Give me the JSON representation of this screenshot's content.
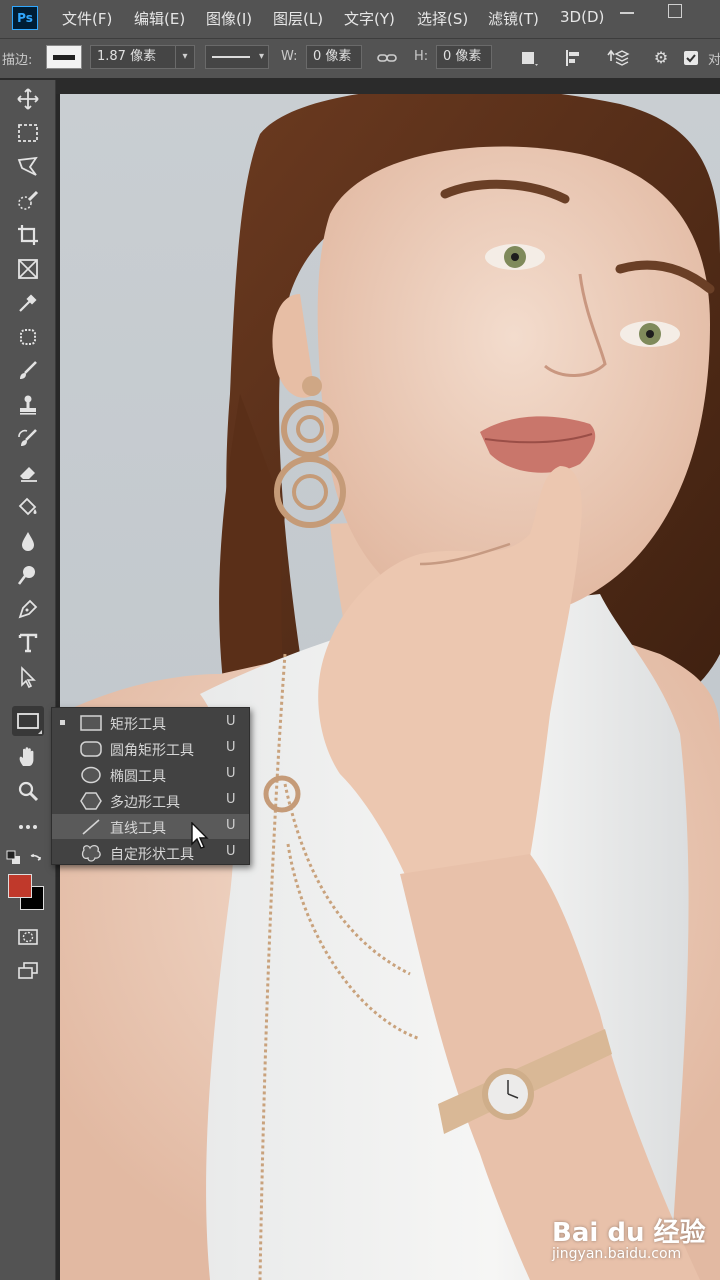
{
  "app": {
    "logo": "Ps",
    "menu": [
      "文件(F)",
      "编辑(E)",
      "图像(I)",
      "图层(L)",
      "文字(Y)",
      "选择(S)",
      "滤镜(T)",
      "3D(D)"
    ]
  },
  "options_bar": {
    "stroke_label": "描边:",
    "stroke_width": "1.87 像素",
    "w_label": "W:",
    "w_value": "0 像素",
    "h_label": "H:",
    "h_value": "0 像素",
    "trailing_label": "对"
  },
  "toolbar": {
    "tools": [
      "move-tool",
      "marquee-tool",
      "lasso-tool",
      "quick-selection-tool",
      "crop-tool",
      "frame-tool",
      "eyedropper-tool",
      "healing-brush-tool",
      "brush-tool",
      "clone-stamp-tool",
      "history-brush-tool",
      "eraser-tool",
      "paint-bucket-tool",
      "blur-tool",
      "dodge-tool",
      "pen-tool",
      "type-tool",
      "path-selection-tool",
      "rectangle-tool",
      "hand-tool",
      "zoom-tool",
      "edit-toolbar"
    ],
    "foreground_color": "#c0392b",
    "background_color": "#000000"
  },
  "flyout": {
    "items": [
      {
        "label": "矩形工具",
        "key": "U",
        "icon": "rectangle-icon",
        "selected": true
      },
      {
        "label": "圆角矩形工具",
        "key": "U",
        "icon": "rounded-rectangle-icon",
        "selected": false
      },
      {
        "label": "椭圆工具",
        "key": "U",
        "icon": "ellipse-icon",
        "selected": false
      },
      {
        "label": "多边形工具",
        "key": "U",
        "icon": "polygon-icon",
        "selected": false
      },
      {
        "label": "直线工具",
        "key": "U",
        "icon": "line-icon",
        "selected": false,
        "hover": true
      },
      {
        "label": "自定形状工具",
        "key": "U",
        "icon": "custom-shape-icon",
        "selected": false
      }
    ]
  },
  "watermark": {
    "brand": "Bai du 经验",
    "url": "jingyan.baidu.com"
  }
}
